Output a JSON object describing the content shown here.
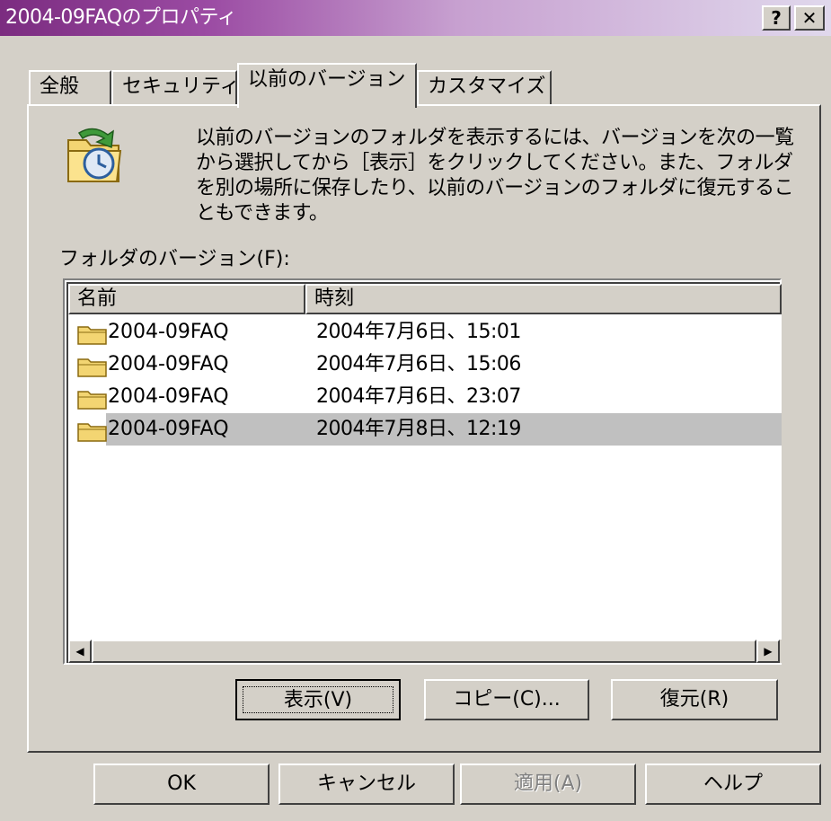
{
  "window": {
    "title": "2004-09FAQのプロパティ",
    "help_button": "?",
    "close_button": "✕"
  },
  "tabs": [
    {
      "label": "全般"
    },
    {
      "label": "セキュリティ"
    },
    {
      "label": "以前のバージョン"
    },
    {
      "label": "カスタマイズ"
    }
  ],
  "panel": {
    "description": "以前のバージョンのフォルダを表示するには、バージョンを次の一覧から選択してから［表示］をクリックしてください。また、フォルダを別の場所に保存したり、以前のバージョンのフォルダに復元することもできます。",
    "list_label": "フォルダのバージョン(F):",
    "columns": {
      "name": "名前",
      "time": "時刻"
    },
    "rows": [
      {
        "name": "2004-09FAQ",
        "time": "2004年7月6日、15:01"
      },
      {
        "name": "2004-09FAQ",
        "time": "2004年7月6日、15:06"
      },
      {
        "name": "2004-09FAQ",
        "time": "2004年7月6日、23:07"
      },
      {
        "name": "2004-09FAQ",
        "time": "2004年7月8日、12:19"
      }
    ],
    "buttons": {
      "view": "表示(V)",
      "copy": "コピー(C)...",
      "restore": "復元(R)"
    }
  },
  "footer": {
    "ok": "OK",
    "cancel": "キャンセル",
    "apply": "適用(A)",
    "help": "ヘルプ"
  },
  "colors": {
    "dialog_bg": "#d4d0c8",
    "title_start": "#7b2c80",
    "selection": "#c0c0c0"
  }
}
